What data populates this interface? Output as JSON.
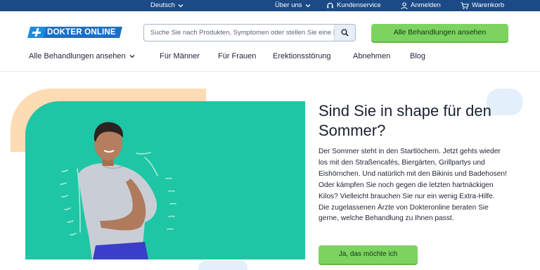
{
  "topbar": {
    "language": "Deutsch",
    "about": "Über uns",
    "service": "Kundenservice",
    "login": "Anmelden",
    "cart": "Warenkorb"
  },
  "header": {
    "logo_text": "DOKTER ONLINE",
    "search_placeholder": "Suche Sie nach Produkten, Symptomen oder stellen Sie eine Frage",
    "cta_label": "Alle Behandlungen ansehen"
  },
  "nav": {
    "items": [
      {
        "label": "Alle Behandlungen ansehen"
      },
      {
        "label": "Für Männer"
      },
      {
        "label": "Für Frauen"
      },
      {
        "label": "Erektionsstörung"
      },
      {
        "label": "Abnehmen"
      },
      {
        "label": "Blog"
      }
    ]
  },
  "hero": {
    "title": "Sind Sie in shape für den Sommer?",
    "body": "Der Sommer steht in den Startlöchern. Jetzt gehts wieder los mit den Straßencafés, Biergärten, Grillpartys und Eishörnchen. Und natürlich mit den Bikinis und Badehosen! Oder kämpfen Sie noch gegen die letzten hartnäckigen Kilos? Vielleicht brauchen Sie nur ein wenig Extra-Hilfe. Die zugelassenen Ärzte von Dokteronline beraten Sie gerne, welche Behandlung zu Ihnen passt.",
    "cta_label": "Ja, das möchte ich"
  },
  "colors": {
    "topbar_bg": "#1b4a86",
    "brand_blue": "#1d6fc0",
    "accent_green": "#7dd35f",
    "hero_teal": "#1ec6a5",
    "hero_peach": "#fcdcb2"
  },
  "icons": {
    "chevron": "chevron-down-icon",
    "headset": "headset-icon",
    "user": "user-icon",
    "cart": "cart-icon",
    "search": "search-icon"
  }
}
